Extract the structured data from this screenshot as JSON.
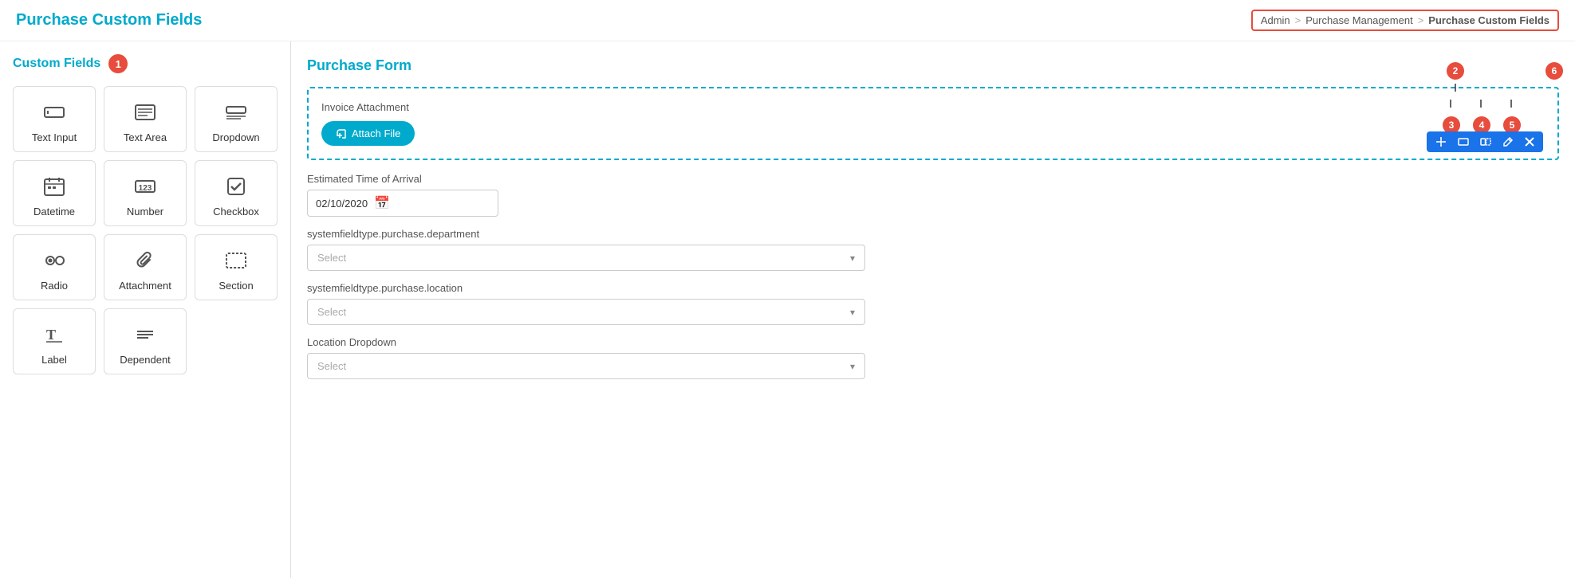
{
  "header": {
    "title": "Purchase Custom Fields",
    "breadcrumb": {
      "admin": "Admin",
      "sep1": ">",
      "purchase_management": "Purchase Management",
      "sep2": ">",
      "active": "Purchase Custom Fields"
    }
  },
  "sidebar": {
    "title": "Custom Fields",
    "badge": "1",
    "fields": [
      {
        "id": "text-input",
        "label": "Text Input",
        "icon": "text-input-icon"
      },
      {
        "id": "text-area",
        "label": "Text Area",
        "icon": "text-area-icon"
      },
      {
        "id": "dropdown",
        "label": "Dropdown",
        "icon": "dropdown-icon"
      },
      {
        "id": "datetime",
        "label": "Datetime",
        "icon": "datetime-icon"
      },
      {
        "id": "number",
        "label": "Number",
        "icon": "number-icon"
      },
      {
        "id": "checkbox",
        "label": "Checkbox",
        "icon": "checkbox-icon"
      },
      {
        "id": "radio",
        "label": "Radio",
        "icon": "radio-icon"
      },
      {
        "id": "attachment",
        "label": "Attachment",
        "icon": "attachment-icon"
      },
      {
        "id": "section",
        "label": "Section",
        "icon": "section-icon"
      },
      {
        "id": "label",
        "label": "Label",
        "icon": "label-icon"
      },
      {
        "id": "dependent",
        "label": "Dependent",
        "icon": "dependent-icon"
      }
    ]
  },
  "content": {
    "title": "Purchase Form",
    "toolbar": {
      "badge2": "2",
      "badge3": "3",
      "badge4": "4",
      "badge5": "5",
      "badge6": "6"
    },
    "invoice_section": {
      "label": "Invoice Attachment",
      "attach_btn": "Attach File"
    },
    "fields": [
      {
        "id": "eta",
        "label": "Estimated Time of Arrival",
        "type": "date",
        "value": "02/10/2020"
      },
      {
        "id": "department",
        "label": "systemfieldtype.purchase.department",
        "type": "select",
        "placeholder": "Select"
      },
      {
        "id": "location",
        "label": "systemfieldtype.purchase.location",
        "type": "select",
        "placeholder": "Select"
      },
      {
        "id": "location_dropdown",
        "label": "Location Dropdown",
        "type": "select",
        "placeholder": "Select"
      }
    ]
  }
}
